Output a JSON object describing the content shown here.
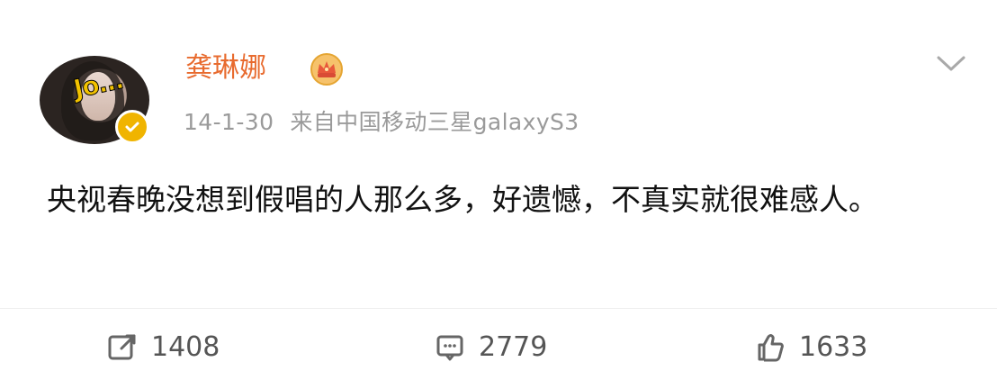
{
  "post": {
    "username": "龚琳娜",
    "timestamp": "14-1-30",
    "source": "来自中国移动三星galaxyS3",
    "text": "央视春晚没想到假唱的人那么多，好遗憾，不真实就很难感人。",
    "avatar_band_text": "Jo…",
    "badges": {
      "verified": "verified-icon",
      "member": "crown-icon"
    },
    "actions": {
      "repost_count": "1408",
      "comment_count": "2779",
      "like_count": "1633"
    },
    "colors": {
      "username": "#e86b2f",
      "meta": "#9a9a9a",
      "badge": "#f0b400",
      "text": "#111111",
      "actions": "#555555"
    },
    "icons": {
      "menu": "chevron-down-icon",
      "repost": "repost-icon",
      "comment": "comment-icon",
      "like": "thumbs-up-icon"
    }
  }
}
